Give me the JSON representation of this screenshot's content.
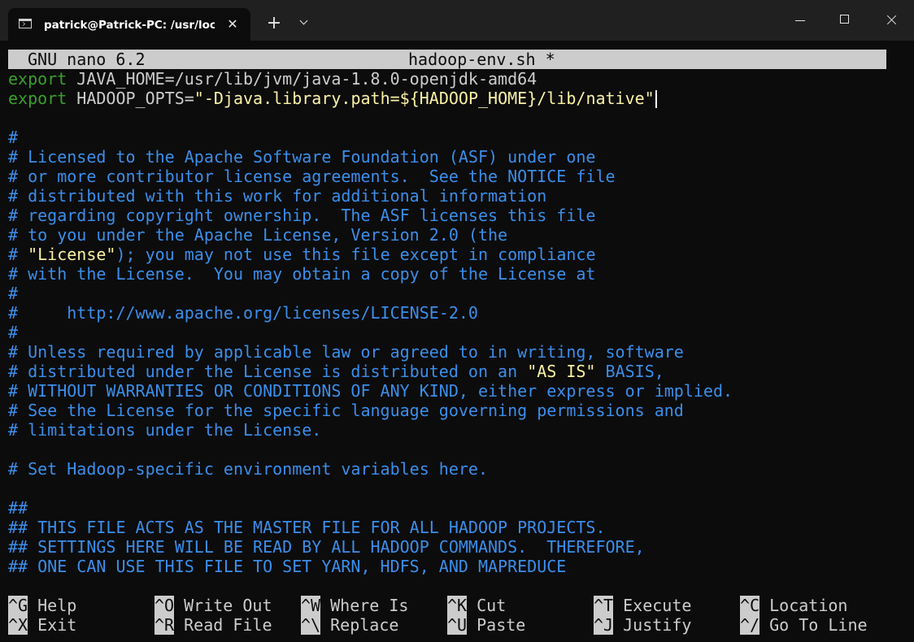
{
  "window": {
    "tab_title": "patrick@Patrick-PC: /usr/local/",
    "new_tab": "+",
    "tab_close": "✕"
  },
  "nano": {
    "version": "GNU nano 6.2",
    "filename": "hadoop-env.sh *"
  },
  "editor": {
    "line1": {
      "kw": "export",
      "text": " JAVA_HOME=/usr/lib/jvm/java-1.8.0-openjdk-amd64"
    },
    "line2": {
      "kw": "export",
      "text_a": " HADOOP_OPTS=",
      "str": "\"-Djava.library.path=${HADOOP_HOME}/lib/native\""
    },
    "comments": [
      "#",
      "# Licensed to the Apache Software Foundation (ASF) under one",
      "# or more contributor license agreements.  See the NOTICE file",
      "# distributed with this work for additional information",
      "# regarding copyright ownership.  The ASF licenses this file",
      "# to you under the Apache License, Version 2.0 (the",
      "); you may not use this file except in compliance",
      "# with the License.  You may obtain a copy of the License at",
      "#",
      "#     http://www.apache.org/licenses/LICENSE-2.0",
      "#",
      "# Unless required by applicable law or agreed to in writing, software",
      "# distributed under the License is distributed on an ",
      " BASIS,",
      "# WITHOUT WARRANTIES OR CONDITIONS OF ANY KIND, either express or implied.",
      "# See the License for the specific language governing permissions and",
      "# limitations under the License.",
      "# Set Hadoop-specific environment variables here.",
      "##",
      "## THIS FILE ACTS AS THE MASTER FILE FOR ALL HADOOP PROJECTS.",
      "## SETTINGS HERE WILL BE READ BY ALL HADOOP COMMANDS.  THEREFORE,",
      "## ONE CAN USE THIS FILE TO SET YARN, HDFS, AND MAPREDUCE"
    ],
    "license_prefix": "# ",
    "license_string": "\"License\"",
    "as_is_string": "\"AS IS\""
  },
  "shortcuts": [
    {
      "key": "^G",
      "label": "Help"
    },
    {
      "key": "^O",
      "label": "Write Out"
    },
    {
      "key": "^W",
      "label": "Where Is"
    },
    {
      "key": "^K",
      "label": "Cut"
    },
    {
      "key": "^T",
      "label": "Execute"
    },
    {
      "key": "^C",
      "label": "Location"
    },
    {
      "key": "^X",
      "label": "Exit"
    },
    {
      "key": "^R",
      "label": "Read File"
    },
    {
      "key": "^\\",
      "label": "Replace"
    },
    {
      "key": "^U",
      "label": "Paste"
    },
    {
      "key": "^J",
      "label": "Justify"
    },
    {
      "key": "^/",
      "label": "Go To Line"
    }
  ]
}
